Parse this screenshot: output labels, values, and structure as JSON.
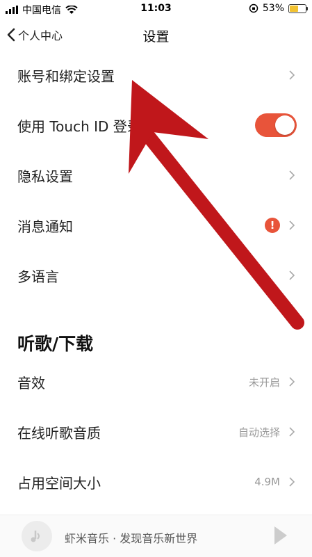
{
  "status_bar": {
    "carrier": "中国电信",
    "time": "11:03",
    "battery_percent": "53%",
    "battery_level": 0.53
  },
  "nav": {
    "back_label": "个人中心",
    "title": "设置"
  },
  "rows": {
    "account": {
      "label": "账号和绑定设置"
    },
    "touch_id": {
      "label": "使用 Touch ID 登录",
      "enabled": true
    },
    "privacy": {
      "label": "隐私设置"
    },
    "notifications": {
      "label": "消息通知",
      "badge": "!"
    },
    "language": {
      "label": "多语言"
    }
  },
  "section_download": {
    "title": "听歌/下载",
    "rows": {
      "sound_effect": {
        "label": "音效",
        "value": "未开启"
      },
      "online_quality": {
        "label": "在线听歌音质",
        "value": "自动选择"
      },
      "storage": {
        "label": "占用空间大小",
        "value": "4.9M"
      }
    }
  },
  "bottom_bar": {
    "text": "虾米音乐 · 发现音乐新世界"
  },
  "colors": {
    "accent": "#e8543a",
    "arrow": "#c0171b"
  }
}
